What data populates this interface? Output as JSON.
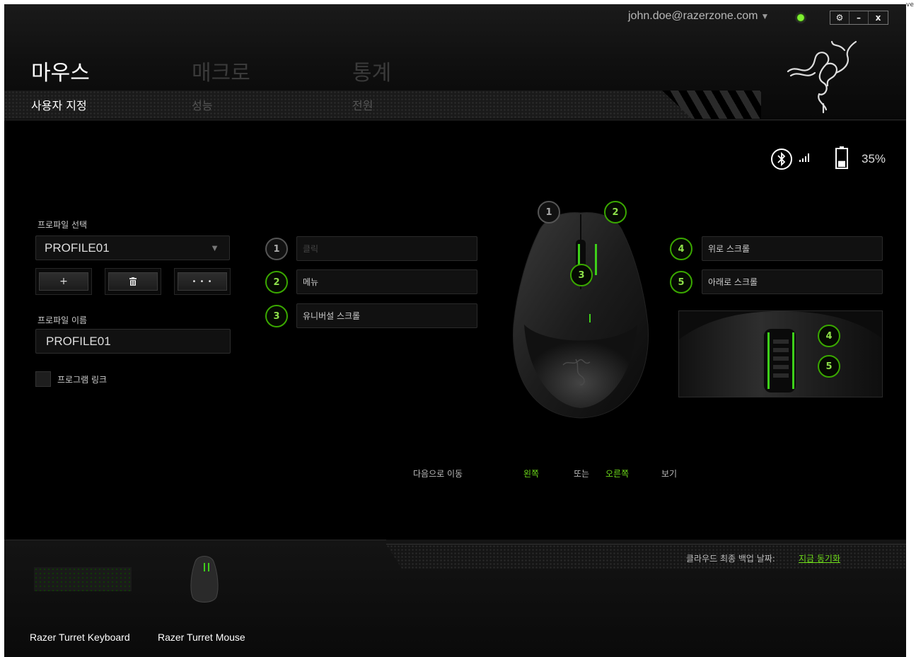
{
  "header": {
    "account_email": "john.doe@razerzone.com",
    "account_caret": "▼",
    "window_controls": [
      "⚙",
      "–",
      "x"
    ],
    "corner_fragment": "ve"
  },
  "nav": {
    "main_tabs": [
      "마우스",
      "매크로",
      "통계"
    ],
    "sub_tabs": [
      "사용자 지정",
      "성능",
      "전원"
    ]
  },
  "status": {
    "battery_percent": "35%",
    "battery_level": 0.35
  },
  "profile": {
    "select_label": "프로파일 선택",
    "selected": "PROFILE01",
    "add_label": "+",
    "delete_label": "🗑",
    "more_label": "• • •",
    "name_label": "프로파일 이름",
    "name_value": "PROFILE01",
    "program_link_label": "프로그램 링크"
  },
  "buttons_left": [
    {
      "num": "1",
      "label": "클릭"
    },
    {
      "num": "2",
      "label": "메뉴"
    },
    {
      "num": "3",
      "label": "유니버설 스크롤"
    }
  ],
  "buttons_right": [
    {
      "num": "4",
      "label": "위로 스크롤"
    },
    {
      "num": "5",
      "label": "아래로 스크롤"
    }
  ],
  "mouse_callouts": [
    "1",
    "2",
    "3"
  ],
  "side_callouts": [
    "4",
    "5"
  ],
  "view_nav": {
    "prefix": "다음으로 이동",
    "left": "왼쪽",
    "or": "또는",
    "right": "오른쪽",
    "suffix": "보기"
  },
  "footer": {
    "backup_label": "클라우드 최종 백업 날짜:",
    "sync_now": "지금 동기화",
    "devices": [
      "Razer Turret Keyboard",
      "Razer Turret Mouse"
    ]
  },
  "colors": {
    "accent_green": "#44d62c",
    "background": "#000000"
  }
}
